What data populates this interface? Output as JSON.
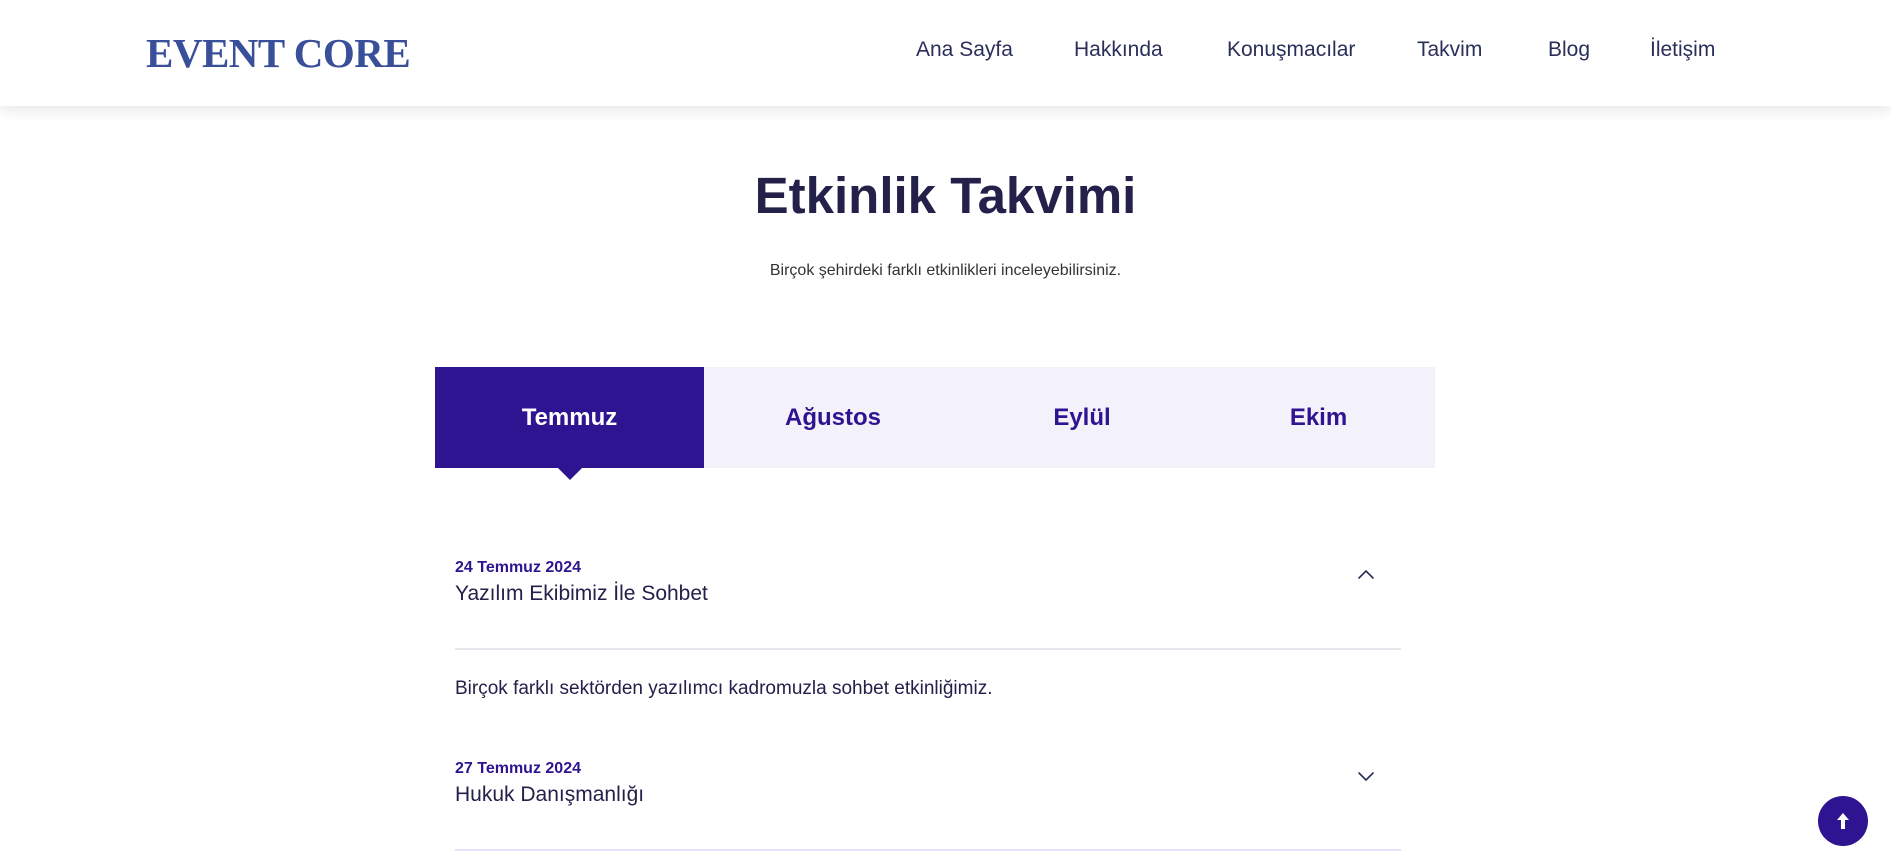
{
  "header": {
    "logo": "EVENT CORE",
    "nav": [
      "Ana Sayfa",
      "Hakkında",
      "Konuşmacılar",
      "Takvim",
      "Blog",
      "İletişim"
    ]
  },
  "section": {
    "title": "Etkinlik Takvimi",
    "subtitle": "Birçok şehirdeki farklı etkinlikleri inceleyebilirsiniz."
  },
  "tabs": {
    "items": [
      "Temmuz",
      "Ağustos",
      "Eylül",
      "Ekim"
    ],
    "active": "Temmuz"
  },
  "events": [
    {
      "date": "24 Temmuz 2024",
      "title": "Yazılım Ekibimiz İle Sohbet",
      "description": "Birçok farklı sektörden yazılımcı kadromuzla sohbet etkinliğimiz.",
      "expanded": true,
      "icon": "chevron-up-icon"
    },
    {
      "date": "27 Temmuz 2024",
      "title": "Hukuk Danışmanlığı",
      "expanded": false,
      "icon": "chevron-down-icon"
    }
  ],
  "scroll_to_top": {
    "icon": "arrow-up-icon"
  },
  "colors": {
    "primary": "#2e1490",
    "logo": "#3a4f9a",
    "heading": "#23204a",
    "tab_bg": "#f3f1f9"
  }
}
